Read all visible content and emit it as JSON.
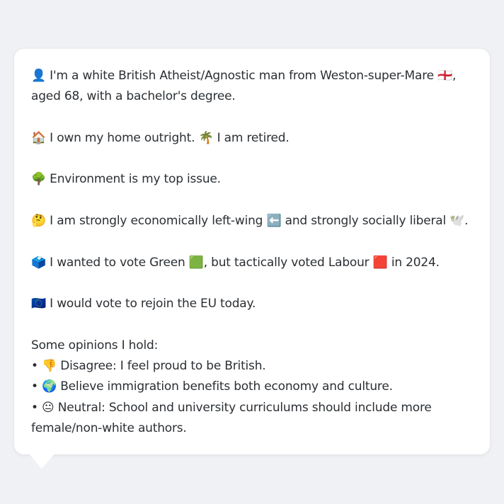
{
  "profile_message": {
    "text": "👤 I'm a white British Atheist/Agnostic man from Weston-super-Mare 🏴󠁧󠁢󠁥󠁮󠁧󠁿, aged 68, with a bachelor's degree.\n\n🏠 I own my home outright. 🌴 I am retired.\n\n🌳 Environment is my top issue.\n\n🤔 I am strongly economically left-wing ⬅️ and strongly socially liberal 🕊️.\n\n🗳️ I wanted to vote Green 🟩, but tactically voted Labour 🟥 in 2024.\n\n🇪🇺 I would vote to rejoin the EU today.\n\nSome opinions I hold:\n• 👎 Disagree: I feel proud to be British.\n• 🌍 Believe immigration benefits both economy and culture.\n• 😐 Neutral: School and university curriculums should include more female/non-white authors."
  }
}
